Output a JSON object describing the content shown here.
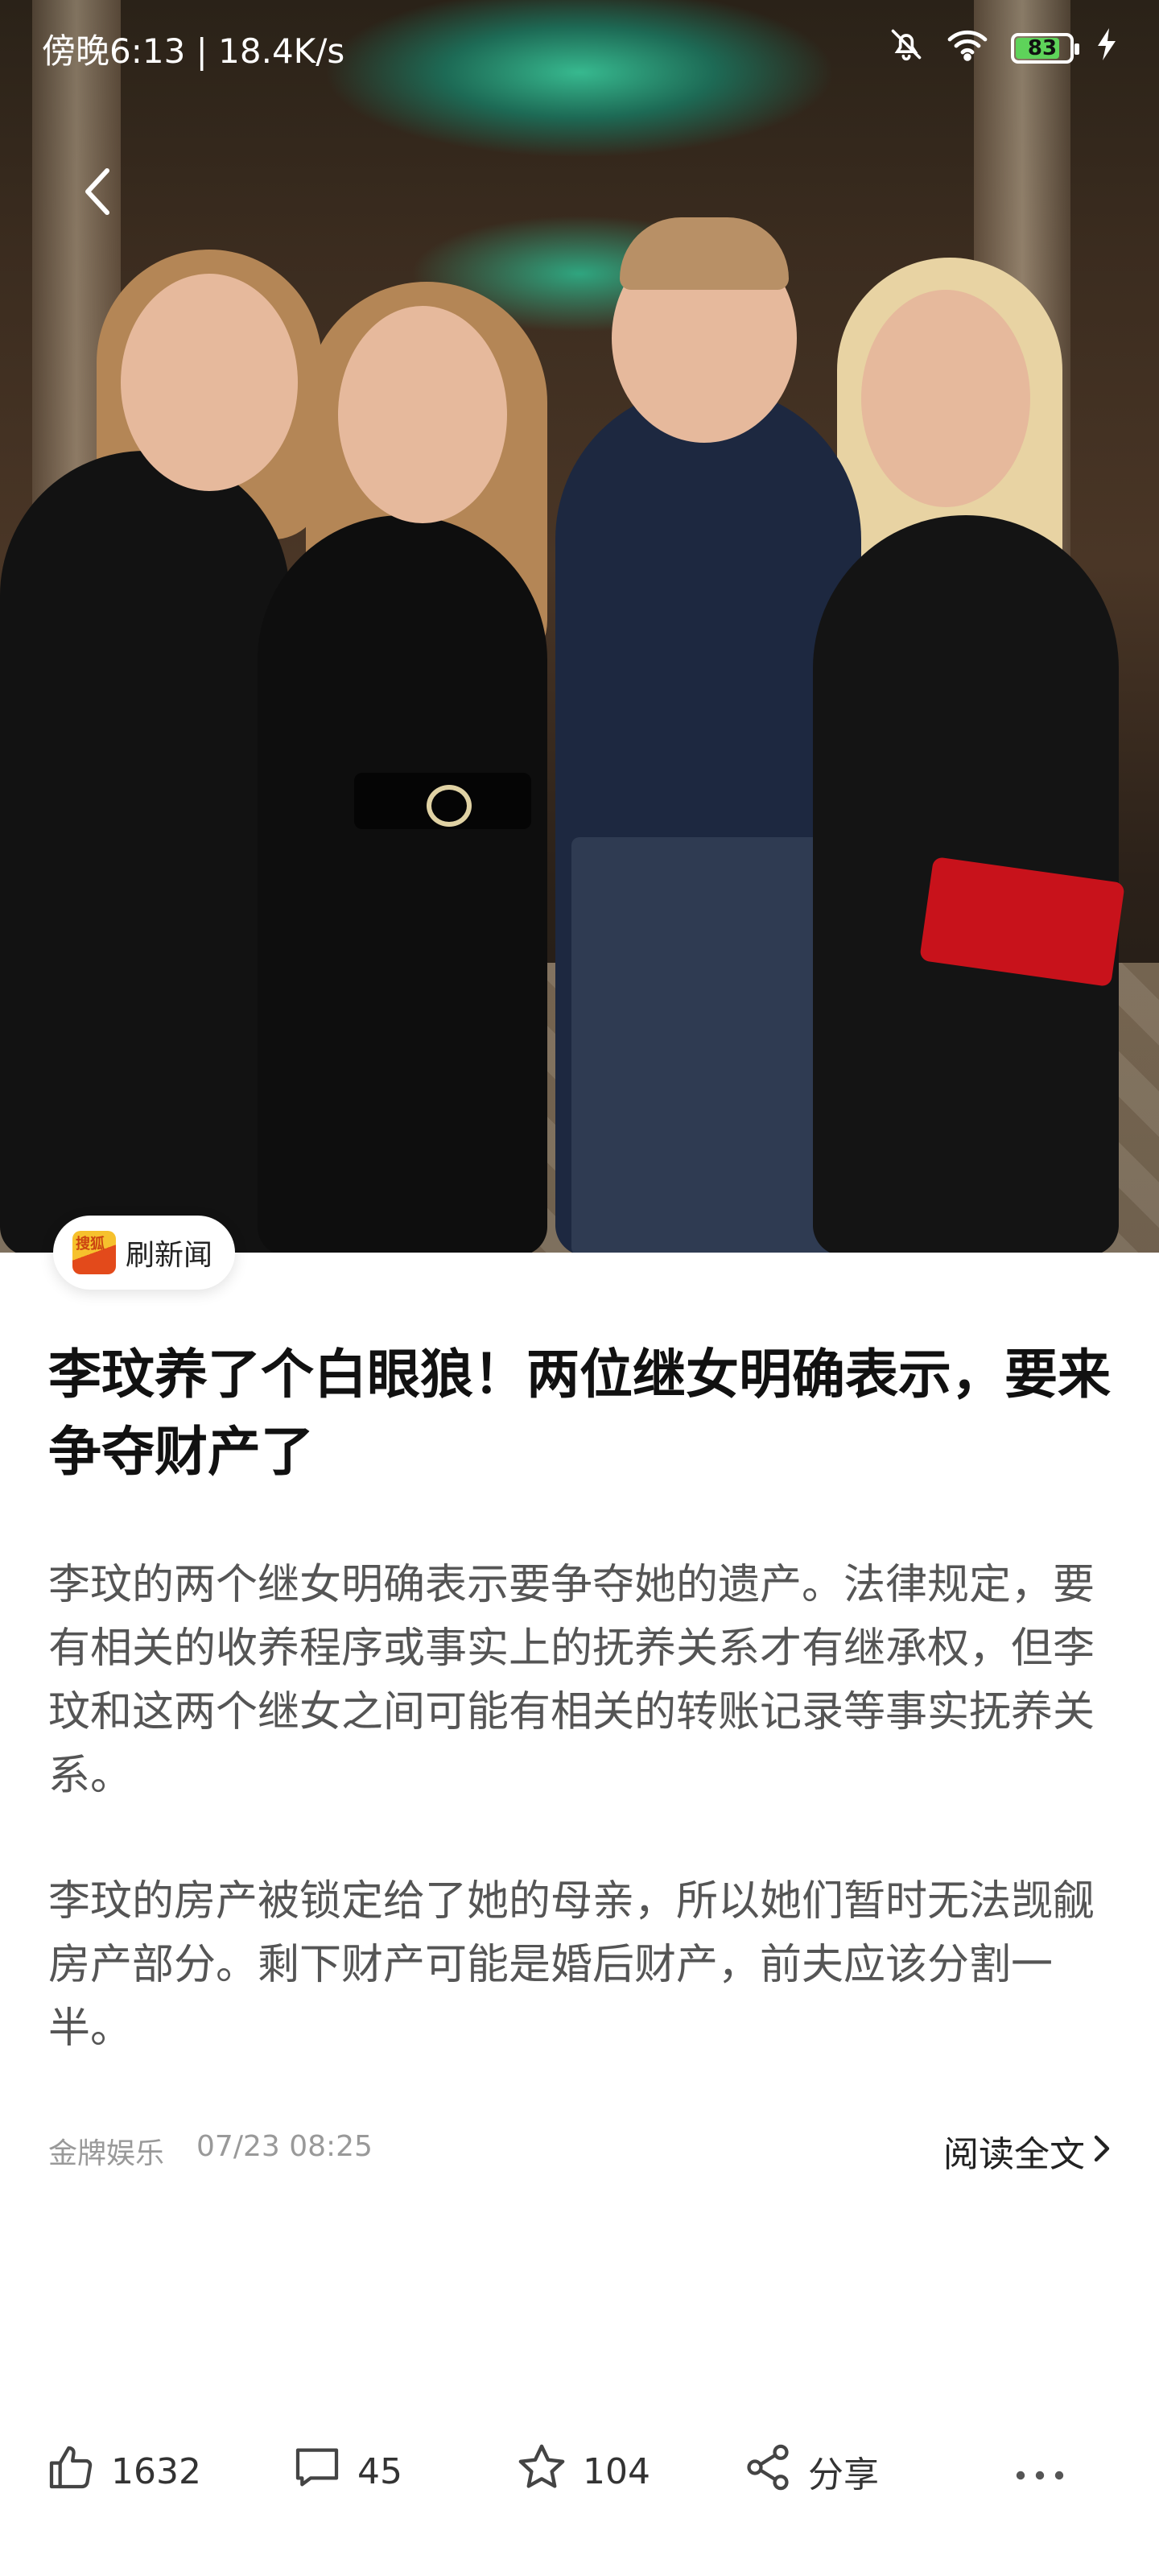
{
  "status_bar": {
    "time_speed": "傍晚6:13 | 18.4K/s",
    "battery_level": "83",
    "battery_fraction": 0.83
  },
  "source": {
    "label": "刷新闻"
  },
  "article": {
    "title": "李玟养了个白眼狼！两位继女明确表示，要来争夺财产了",
    "paragraphs": [
      "李玟的两个继女明确表示要争夺她的遗产。法律规定，要有相关的收养程序或事实上的抚养关系才有继承权，但李玟和这两个继女之间可能有相关的转账记录等事实抚养关系。",
      "李玟的房产被锁定给了她的母亲，所以她们暂时无法觊觎房产部分。剩下财产可能是婚后财产，前夫应该分割一半。"
    ],
    "author": "金牌娱乐",
    "date": "07/23 08:25",
    "read_full_label": "阅读全文"
  },
  "actions": {
    "like_count": "1632",
    "comment_count": "45",
    "favorite_count": "104",
    "share_label": "分享"
  },
  "icons": {
    "back": "back-icon",
    "mute": "bell-off-icon",
    "wifi": "wifi-icon",
    "charging": "charging-icon",
    "like": "thumbs-up-icon",
    "comment": "comment-icon",
    "favorite": "star-icon",
    "share": "share-icon",
    "more": "more-icon"
  }
}
